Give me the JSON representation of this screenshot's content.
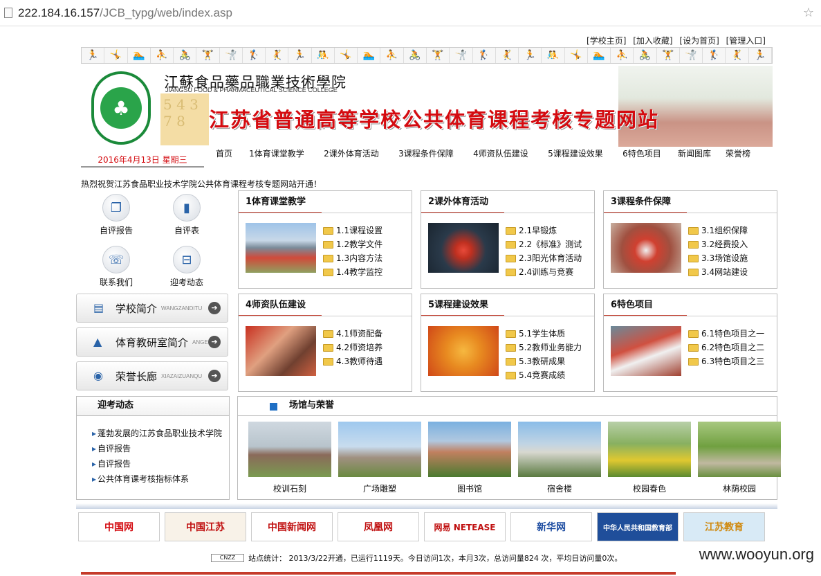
{
  "browser": {
    "host": "222.184.16.157",
    "path": "/JCB_typg/web/index.asp"
  },
  "toplinks": [
    "[学校主页]",
    "[加入收藏]",
    "[设为首页]",
    "[管理入口]"
  ],
  "banner": {
    "school_cn": "江蘇食品藥品職業技術學院",
    "school_en": "JIANGSU FOOD & PHARMACEUTICAL SCIENCE COLLEGE",
    "title": "江苏省普通高等学校公共体育课程考核专题网站",
    "date": "2016年4月13日 星期三"
  },
  "nav": [
    "首页",
    "1体育课堂教学",
    "2课外体育活动",
    "3课程条件保障",
    "4师资队伍建设",
    "5课程建设效果",
    "6特色项目",
    "新闻图库",
    "荣誉榜"
  ],
  "marquee": "热烈祝贺江苏食品职业技术学院公共体育课程考核专题网站开通！",
  "quick": [
    "自评报告",
    "自评表",
    "联系我们",
    "迎考动态"
  ],
  "sidebuttons": [
    {
      "label": "学校简介",
      "sub": "WANGZANDITU"
    },
    {
      "label": "体育教研室简介",
      "sub": "ANGE"
    },
    {
      "label": "荣誉长廊",
      "sub": "XIAZAIZUANQU"
    }
  ],
  "panels": [
    {
      "title": "1体育课堂教学",
      "items": [
        "1.1课程设置",
        "1.2教学文件",
        "1.3内容方法",
        "1.4教学监控"
      ]
    },
    {
      "title": "2课外体育活动",
      "items": [
        "2.1早锻炼",
        "2.2《标准》测试",
        "2.3阳光体育活动",
        "2.4训练与竞赛"
      ]
    },
    {
      "title": "3课程条件保障",
      "items": [
        "3.1组织保障",
        "3.2经费投入",
        "3.3场馆设施",
        "3.4网站建设"
      ]
    },
    {
      "title": "4师资队伍建设",
      "items": [
        "4.1师资配备",
        "4.2师资培养",
        "4.3教师待遇"
      ]
    },
    {
      "title": "5课程建设效果",
      "items": [
        "5.1学生体质",
        "5.2教师业务能力",
        "5.3教研成果",
        "5.4竞赛成绩"
      ]
    },
    {
      "title": "6特色项目",
      "items": [
        "6.1特色项目之一",
        "6.2特色项目之二",
        "6.3特色项目之三"
      ]
    }
  ],
  "news": {
    "title": "迎考动态",
    "items": [
      "蓬勃发展的江苏食品职业技术学院",
      "自评报告",
      "自评报告",
      "公共体育课考核指标体系"
    ]
  },
  "venues": {
    "title": "场馆与荣誉",
    "items": [
      "校训石刻",
      "广场雕塑",
      "图书馆",
      "宿舍楼",
      "校园春色",
      "林荫校园"
    ]
  },
  "links": [
    "中国网",
    "中国江苏",
    "中国新闻网",
    "凤凰网",
    "网易 NETEASE",
    "新华网",
    "中华人民共和国教育部",
    "江苏教育"
  ],
  "stats": {
    "badge": "CNZZ",
    "text": "站点统计： 2013/3/22开通，已运行1119天。今日访问1次，本月3次，总访问量824 次，平均日访问量0次。"
  },
  "watermark": "www.wooyun.org"
}
